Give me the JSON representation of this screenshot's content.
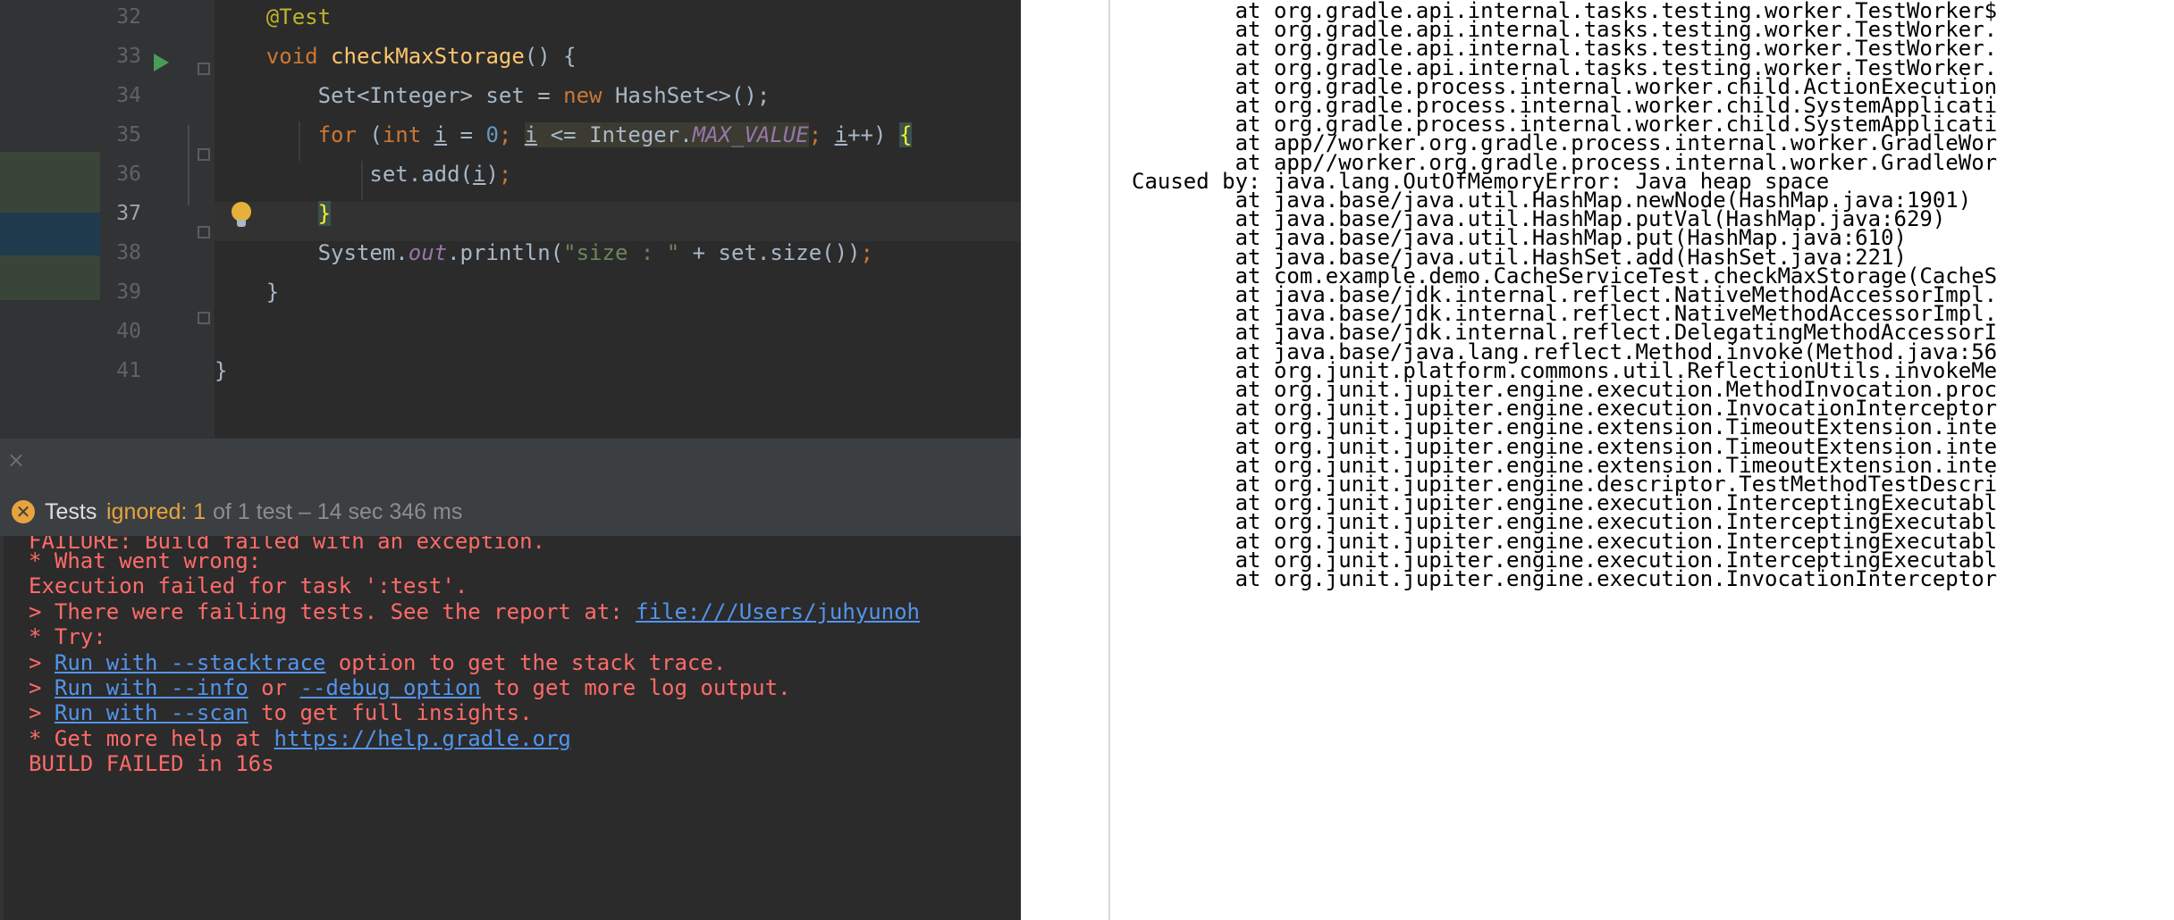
{
  "editor": {
    "line_numbers": [
      "32",
      "33",
      "34",
      "35",
      "36",
      "37",
      "38",
      "39",
      "40",
      "41"
    ],
    "lines": [
      {
        "parts": [
          {
            "t": "    ",
            "c": ""
          },
          {
            "t": "@Test",
            "c": "ann"
          }
        ]
      },
      {
        "parts": [
          {
            "t": "    ",
            "c": ""
          },
          {
            "t": "void ",
            "c": "kw"
          },
          {
            "t": "checkMaxStorage",
            "c": "fn"
          },
          {
            "t": "() {",
            "c": ""
          }
        ]
      },
      {
        "parts": [
          {
            "t": "        Set<Integer> set = ",
            "c": ""
          },
          {
            "t": "new ",
            "c": "kw"
          },
          {
            "t": "HashSet<>();",
            "c": ""
          }
        ]
      },
      {
        "parts": [
          {
            "t": "        ",
            "c": ""
          },
          {
            "t": "for ",
            "c": "kw"
          },
          {
            "t": "(",
            "c": ""
          },
          {
            "t": "int ",
            "c": "kw"
          },
          {
            "t": "i",
            "c": "var-u"
          },
          {
            "t": " = ",
            "c": ""
          },
          {
            "t": "0",
            "c": "num"
          },
          {
            "t": "; ",
            "c": "kw"
          },
          {
            "t": "i",
            "c": "var-u hl-cond"
          },
          {
            "t": " <= Integer.",
            "c": "hl-cond"
          },
          {
            "t": "MAX_VALUE",
            "c": "const hl-cond"
          },
          {
            "t": "; ",
            "c": "kw"
          },
          {
            "t": "i",
            "c": "var-u"
          },
          {
            "t": "++) ",
            "c": ""
          },
          {
            "t": "{",
            "c": "hl-brace"
          }
        ]
      },
      {
        "parts": [
          {
            "t": "            set.add(",
            "c": ""
          },
          {
            "t": "i",
            "c": "var-u"
          },
          {
            "t": ")",
            "c": ""
          },
          {
            "t": ";",
            "c": "kw"
          }
        ]
      },
      {
        "parts": [
          {
            "t": "        ",
            "c": ""
          },
          {
            "t": "}",
            "c": "hl-brace"
          }
        ]
      },
      {
        "parts": [
          {
            "t": "        System.",
            "c": ""
          },
          {
            "t": "out",
            "c": "field"
          },
          {
            "t": ".println(",
            "c": ""
          },
          {
            "t": "\"size : \"",
            "c": "str"
          },
          {
            "t": " + set.size())",
            "c": ""
          },
          {
            "t": ";",
            "c": "kw"
          }
        ]
      },
      {
        "parts": [
          {
            "t": "    }",
            "c": ""
          }
        ]
      },
      {
        "parts": [
          {
            "t": "",
            "c": ""
          }
        ]
      },
      {
        "parts": [
          {
            "t": "}",
            "c": ""
          }
        ]
      }
    ]
  },
  "close_glyph": "×",
  "tests_bar": {
    "icon_glyph": "✕",
    "label": "Tests",
    "ignored": "ignored: 1",
    "summary": "of 1 test – 14 sec 346 ms"
  },
  "console": {
    "partial_top": "FAILURE: Build failed with an exception.",
    "lines": [
      [
        {
          "t": "* What went wrong:",
          "link": false
        }
      ],
      [
        {
          "t": "Execution failed for task ':test'.",
          "link": false
        }
      ],
      [
        {
          "t": "> There were failing tests. See the report at: ",
          "link": false
        },
        {
          "t": "file:///Users/juhyunoh",
          "link": true
        }
      ],
      [
        {
          "t": "* Try:",
          "link": false
        }
      ],
      [
        {
          "t": "> ",
          "link": false
        },
        {
          "t": "Run with --stacktrace",
          "link": true
        },
        {
          "t": " option to get the stack trace.",
          "link": false
        }
      ],
      [
        {
          "t": "> ",
          "link": false
        },
        {
          "t": "Run with --info",
          "link": true
        },
        {
          "t": " or ",
          "link": false
        },
        {
          "t": "--debug option",
          "link": true
        },
        {
          "t": " to get more log output.",
          "link": false
        }
      ],
      [
        {
          "t": "> ",
          "link": false
        },
        {
          "t": "Run with --scan",
          "link": true
        },
        {
          "t": " to get full insights.",
          "link": false
        }
      ],
      [
        {
          "t": "* Get more help at ",
          "link": false
        },
        {
          "t": "https://help.gradle.org",
          "link": true
        }
      ],
      [
        {
          "t": "BUILD FAILED in 16s",
          "link": false
        }
      ]
    ]
  },
  "stacktrace": [
    "        at org.gradle.api.internal.tasks.testing.worker.TestWorker$",
    "        at org.gradle.api.internal.tasks.testing.worker.TestWorker.",
    "        at org.gradle.api.internal.tasks.testing.worker.TestWorker.",
    "        at org.gradle.api.internal.tasks.testing.worker.TestWorker.",
    "        at org.gradle.process.internal.worker.child.ActionExecution",
    "        at org.gradle.process.internal.worker.child.SystemApplicati",
    "        at org.gradle.process.internal.worker.child.SystemApplicati",
    "        at app//worker.org.gradle.process.internal.worker.GradleWor",
    "        at app//worker.org.gradle.process.internal.worker.GradleWor",
    "Caused by: java.lang.OutOfMemoryError: Java heap space",
    "        at java.base/java.util.HashMap.newNode(HashMap.java:1901)",
    "        at java.base/java.util.HashMap.putVal(HashMap.java:629)",
    "        at java.base/java.util.HashMap.put(HashMap.java:610)",
    "        at java.base/java.util.HashSet.add(HashSet.java:221)",
    "        at com.example.demo.CacheServiceTest.checkMaxStorage(CacheS",
    "        at java.base/jdk.internal.reflect.NativeMethodAccessorImpl.",
    "        at java.base/jdk.internal.reflect.NativeMethodAccessorImpl.",
    "        at java.base/jdk.internal.reflect.DelegatingMethodAccessorI",
    "        at java.base/java.lang.reflect.Method.invoke(Method.java:56",
    "        at org.junit.platform.commons.util.ReflectionUtils.invokeMe",
    "        at org.junit.jupiter.engine.execution.MethodInvocation.proc",
    "        at org.junit.jupiter.engine.execution.InvocationInterceptor",
    "        at org.junit.jupiter.engine.extension.TimeoutExtension.inte",
    "        at org.junit.jupiter.engine.extension.TimeoutExtension.inte",
    "        at org.junit.jupiter.engine.extension.TimeoutExtension.inte",
    "        at org.junit.jupiter.engine.descriptor.TestMethodTestDescri",
    "        at org.junit.jupiter.engine.execution.InterceptingExecutabl",
    "        at org.junit.jupiter.engine.execution.InterceptingExecutabl",
    "        at org.junit.jupiter.engine.execution.InterceptingExecutabl",
    "        at org.junit.jupiter.engine.execution.InterceptingExecutabl",
    "        at org.junit.jupiter.engine.execution.InvocationInterceptor"
  ]
}
